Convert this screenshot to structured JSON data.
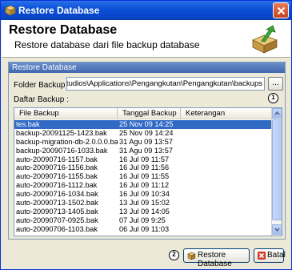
{
  "window": {
    "title": "Restore Database"
  },
  "header": {
    "title": "Restore Database",
    "subtitle": "Restore database dari file backup database"
  },
  "panel": {
    "title": "Restore Database",
    "folder_label": "Folder Backup :",
    "folder_value": ":\\Golden T Studios\\Applications\\Pengangkutan\\Pengangkutan\\backups",
    "browse_label": "...",
    "list_label": "Daftar Backup :",
    "badge_1": "1"
  },
  "table": {
    "columns": [
      "File Backup",
      "Tanggal Backup",
      "Keterangan"
    ],
    "rows": [
      {
        "file": "tes.bak",
        "date": "25 Nov 09 14:25",
        "note": "",
        "selected": true
      },
      {
        "file": "backup-20091125-1423.bak",
        "date": "25 Nov 09 14:24",
        "note": ""
      },
      {
        "file": "backup-migration-db-2.0.0.0.bak",
        "date": "31 Agu 09 13:57",
        "note": ""
      },
      {
        "file": "backup-20090716-1033.bak",
        "date": "31 Agu 09 13:57",
        "note": ""
      },
      {
        "file": "auto-20090716-1157.bak",
        "date": "16 Jul 09 11:57",
        "note": ""
      },
      {
        "file": "auto-20090716-1156.bak",
        "date": "16 Jul 09 11:56",
        "note": ""
      },
      {
        "file": "auto-20090716-1155.bak",
        "date": "16 Jul 09 11:55",
        "note": ""
      },
      {
        "file": "auto-20090716-1112.bak",
        "date": "16 Jul 09 11:12",
        "note": ""
      },
      {
        "file": "auto-20090716-1034.bak",
        "date": "16 Jul 09 10:34",
        "note": ""
      },
      {
        "file": "auto-20090713-1502.bak",
        "date": "13 Jul 09 15:02",
        "note": ""
      },
      {
        "file": "auto-20090713-1405.bak",
        "date": "13 Jul 09 14:05",
        "note": ""
      },
      {
        "file": "auto-20090707-0925.bak",
        "date": "07 Jul 09 9:25",
        "note": ""
      },
      {
        "file": "auto-20090706-1103.bak",
        "date": "06 Jul 09 11:03",
        "note": ""
      }
    ]
  },
  "footer": {
    "badge_2": "2",
    "restore_label": "Restore Database",
    "cancel_label": "Batal"
  },
  "colors": {
    "selection": "#316ac5",
    "titlebar": "#0a4fd6"
  }
}
